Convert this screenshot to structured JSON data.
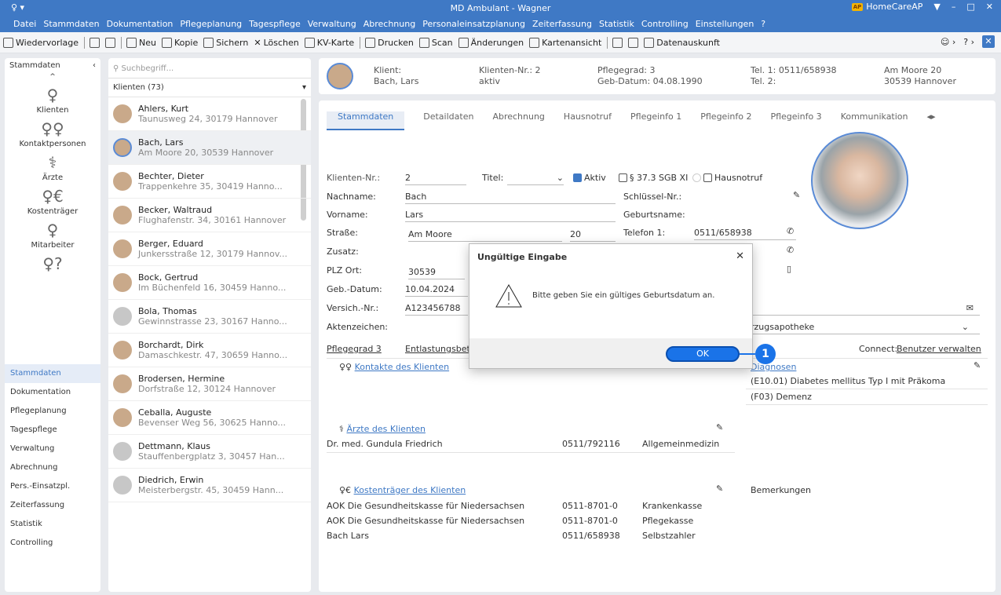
{
  "titlebar": {
    "title": "MD Ambulant - Wagner",
    "brand": "HomeCareAP",
    "brand_badge": "AP",
    "left_icons": "♀ ▾"
  },
  "menu": [
    "Datei",
    "Stammdaten",
    "Dokumentation",
    "Pflegeplanung",
    "Tagespflege",
    "Verwaltung",
    "Abrechnung",
    "Personaleinsatzplanung",
    "Zeiterfassung",
    "Statistik",
    "Controlling",
    "Einstellungen",
    "?"
  ],
  "toolbar": {
    "items": [
      "Wiedervorlage",
      "Neu",
      "Kopie",
      "Sichern",
      "Löschen",
      "KV-Karte",
      "Drucken",
      "Scan",
      "Änderungen",
      "Kartenansicht",
      "Datenauskunft"
    ]
  },
  "leftnav": {
    "header": "Stammdaten",
    "icons": [
      "Klienten",
      "Kontaktpersonen",
      "Ärzte",
      "Kostenträger",
      "Mitarbeiter"
    ],
    "list": [
      "Stammdaten",
      "Dokumentation",
      "Pflegeplanung",
      "Tagespflege",
      "Verwaltung",
      "Abrechnung",
      "Pers.-Einsatzpl.",
      "Zeiterfassung",
      "Statistik",
      "Controlling"
    ]
  },
  "clients": {
    "search_placeholder": "Suchbegriff...",
    "header": "Klienten (73)",
    "items": [
      {
        "name": "Ahlers, Kurt",
        "addr": "Taunusweg 24, 30179 Hannover"
      },
      {
        "name": "Bach, Lars",
        "addr": "Am Moore 20, 30539 Hannover"
      },
      {
        "name": "Bechter, Dieter",
        "addr": "Trappenkehre 35, 30419 Hanno..."
      },
      {
        "name": "Becker, Waltraud",
        "addr": "Flughafenstr. 34, 30161 Hannover"
      },
      {
        "name": "Berger, Eduard",
        "addr": "Junkersstraße 12, 30179 Hannov..."
      },
      {
        "name": "Bock, Gertrud",
        "addr": "Im Büchenfeld 16, 30459 Hanno..."
      },
      {
        "name": "Bola, Thomas",
        "addr": "Gewinnstrasse 23, 30167 Hanno..."
      },
      {
        "name": "Borchardt, Dirk",
        "addr": "Damaschkestr. 47, 30659 Hanno..."
      },
      {
        "name": "Brodersen, Hermine",
        "addr": "Dorfstraße 12, 30124 Hannover"
      },
      {
        "name": "Ceballa, Auguste",
        "addr": "Bevenser Weg 56, 30625 Hanno..."
      },
      {
        "name": "Dettmann, Klaus",
        "addr": "Stauffenbergplatz 3, 30457 Han..."
      },
      {
        "name": "Diedrich, Erwin",
        "addr": "Meisterbergstr. 45, 30459 Hann..."
      }
    ]
  },
  "header": {
    "l1": "Klient:",
    "l1v": "Bach, Lars",
    "l2": "Klienten-Nr.: 2",
    "l2v": "aktiv",
    "l3": "Pflegegrad: 3",
    "l3v": "Geb-Datum: 04.08.1990",
    "l4": "Tel. 1: 0511/658938",
    "l4v": "Tel. 2:",
    "l5": "Am Moore 20",
    "l5v": "30539 Hannover"
  },
  "tabs": [
    "Stammdaten",
    "Detaildaten",
    "Abrechnung",
    "Hausnotruf",
    "Pflegeinfo 1",
    "Pflegeinfo 2",
    "Pflegeinfo 3",
    "Kommunikation"
  ],
  "form": {
    "klnr_l": "Klienten-Nr.:",
    "klnr": "2",
    "titel_l": "Titel:",
    "aktiv": "Aktiv",
    "sgb": "§ 37.3 SGB XI",
    "hausnotruf": "Hausnotruf",
    "nachname_l": "Nachname:",
    "nachname": "Bach",
    "schluessel_l": "Schlüssel-Nr.:",
    "vorname_l": "Vorname:",
    "vorname": "Lars",
    "geburtsname_l": "Geburtsname:",
    "strasse_l": "Straße:",
    "strasse": "Am Moore",
    "hausnr": "20",
    "tel1_l": "Telefon 1:",
    "tel1": "0511/658938",
    "zusatz_l": "Zusatz:",
    "plz_l": "PLZ Ort:",
    "plz": "30539",
    "gebdatum_l": "Geb.-Datum:",
    "gebdatum": "10.04.2024",
    "versich_l": "Versich.-Nr.:",
    "versich": "A123456788",
    "akten_l": "Aktenzeichen:",
    "apotheke": "rzugsapotheke",
    "pflegegrad_link": "Pflegegrad 3",
    "entlastung_link": "Entlastungsbet",
    "connect_l": "Connect:",
    "connect_link": "Benutzer verwalten"
  },
  "sections": {
    "kontakte": "Kontakte des Klienten",
    "diagnosen": "Diagnosen",
    "diag1": "(E10.01) Diabetes mellitus Typ I mit Präkoma",
    "diag2": "(F03) Demenz",
    "aerzte": "Ärzte des Klienten",
    "arzt": "Dr. med. Gundula Friedrich",
    "arzt_tel": "0511/792116",
    "arzt_fach": "Allgemeinmedizin",
    "kosten": "Kostenträger des Klienten",
    "bemerkungen": "Bemerkungen",
    "k_rows": [
      [
        "AOK Die Gesundheitskasse für Niedersachsen",
        "0511-8701-0",
        "Krankenkasse"
      ],
      [
        "AOK Die Gesundheitskasse für Niedersachsen",
        "0511-8701-0",
        "Pflegekasse"
      ],
      [
        "Bach Lars",
        "0511/658938",
        "Selbstzahler"
      ]
    ]
  },
  "dialog": {
    "title": "Ungültige Eingabe",
    "message": "Bitte geben Sie ein gültiges Geburtsdatum an.",
    "ok": "OK",
    "close": "✕"
  },
  "callout": "1"
}
